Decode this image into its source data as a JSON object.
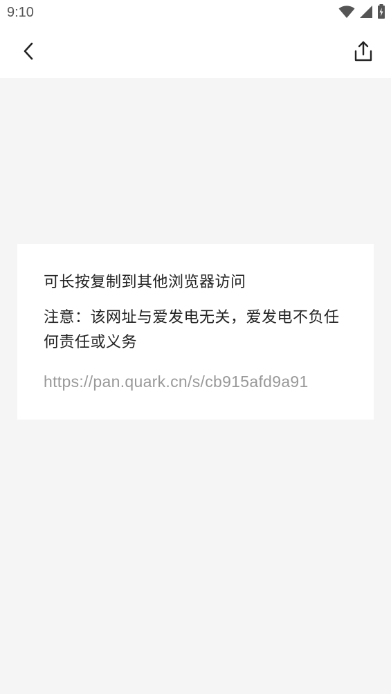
{
  "status_bar": {
    "time": "9:10",
    "icons": [
      "wifi-icon",
      "signal-icon",
      "battery-icon"
    ]
  },
  "nav": {
    "back_icon": "chevron-left-icon",
    "share_icon": "share-icon"
  },
  "card": {
    "hint": "可长按复制到其他浏览器访问",
    "notice": "注意：该网址与爱发电无关，爱发电不负任何责任或义务",
    "url": "https://pan.quark.cn/s/cb915afd9a91"
  },
  "colors": {
    "background": "#f5f5f5",
    "card": "#ffffff",
    "text": "#222222",
    "url_text": "#999999"
  }
}
